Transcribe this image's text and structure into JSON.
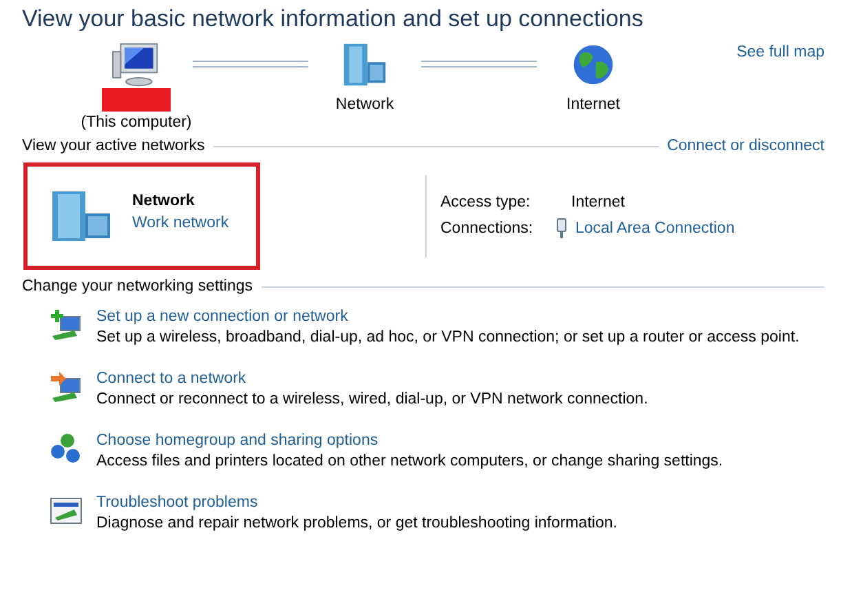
{
  "title": "View your basic network information and set up connections",
  "map": {
    "nodes": [
      {
        "kind": "computer",
        "label": "(This computer)",
        "redacted": true
      },
      {
        "kind": "network",
        "label": "Network",
        "redacted": false
      },
      {
        "kind": "internet",
        "label": "Internet",
        "redacted": false
      }
    ],
    "link": "See full map"
  },
  "active": {
    "heading": "View your active networks",
    "link": "Connect or disconnect",
    "highlighted": true,
    "network": {
      "name": "Network",
      "type": "Work network"
    },
    "details": [
      {
        "label": "Access type:",
        "value": "Internet",
        "kind": "text"
      },
      {
        "label": "Connections:",
        "value": "Local Area Connection",
        "kind": "link"
      }
    ]
  },
  "settings": {
    "heading": "Change your networking settings",
    "tasks": [
      {
        "kind": "new",
        "title": "Set up a new connection or network",
        "description": "Set up a wireless, broadband, dial-up, ad hoc, or VPN connection; or set up a router or access point."
      },
      {
        "kind": "connect",
        "title": "Connect to a network",
        "description": "Connect or reconnect to a wireless, wired, dial-up, or VPN network connection."
      },
      {
        "kind": "homegroup",
        "title": "Choose homegroup and sharing options",
        "description": "Access files and printers located on other network computers, or change sharing settings."
      },
      {
        "kind": "troubleshoot",
        "title": "Troubleshoot problems",
        "description": "Diagnose and repair network problems, or get troubleshooting information."
      }
    ]
  }
}
